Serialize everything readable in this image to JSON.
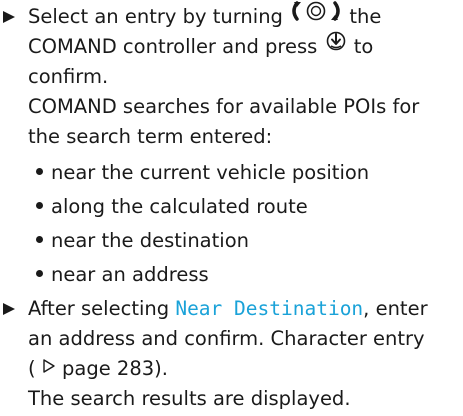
{
  "step1": {
    "line1_a": "Select an entry by turning",
    "line1_b": "the",
    "line2_a": "COMAND controller and press",
    "line2_b": "to",
    "line3": "confirm.",
    "line4": "COMAND searches for available POIs for",
    "line5": "the search term entered:",
    "turn_icon": "controller-turn-icon",
    "press_icon": "controller-press-icon"
  },
  "bullets": [
    "near the current vehicle position",
    "along the calculated route",
    "near the destination",
    "near an address"
  ],
  "step2": {
    "line1_a": "After selecting",
    "menu_item": "Near Destination",
    "line1_b": ", enter",
    "line2": "an address and confirm. Character entry",
    "ref_open": "(",
    "ref_text": " page 283).",
    "line4": "The search results are displayed."
  },
  "colors": {
    "text": "#1a1a1a",
    "menu_item": "#1aa2d8"
  }
}
